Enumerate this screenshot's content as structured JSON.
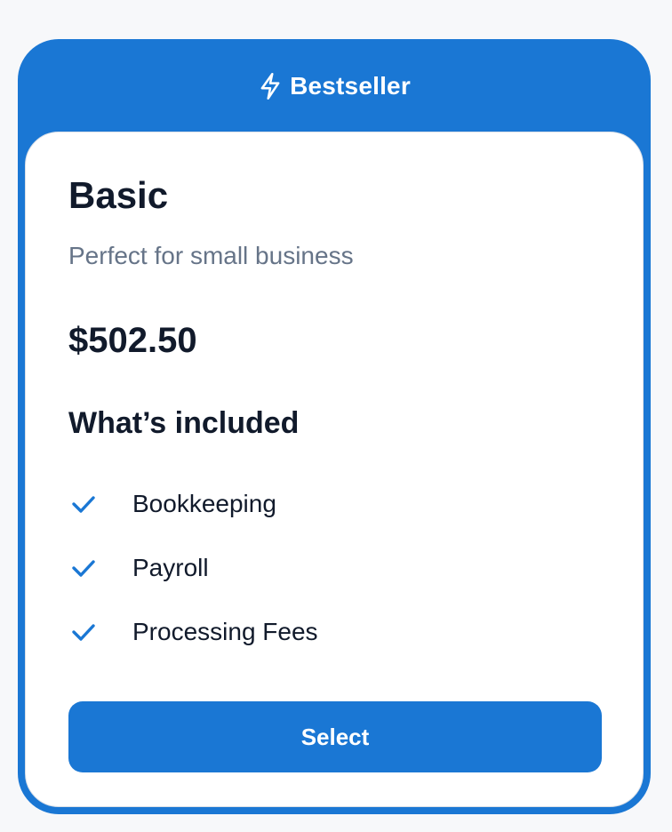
{
  "badge": {
    "icon": "lightning-bolt-icon",
    "label": "Bestseller"
  },
  "plan": {
    "name": "Basic",
    "description": "Perfect for small business",
    "price": "$502.50"
  },
  "features": {
    "heading": "What’s included",
    "items": [
      {
        "label": "Bookkeeping",
        "icon": "check-icon"
      },
      {
        "label": "Payroll",
        "icon": "check-icon"
      },
      {
        "label": "Processing Fees",
        "icon": "check-icon"
      }
    ]
  },
  "actions": {
    "select_label": "Select"
  },
  "colors": {
    "accent": "#1a77d4",
    "text_primary": "#111a2b",
    "text_secondary": "#667488",
    "page_background": "#f7f8fa",
    "card_background": "#ffffff"
  }
}
